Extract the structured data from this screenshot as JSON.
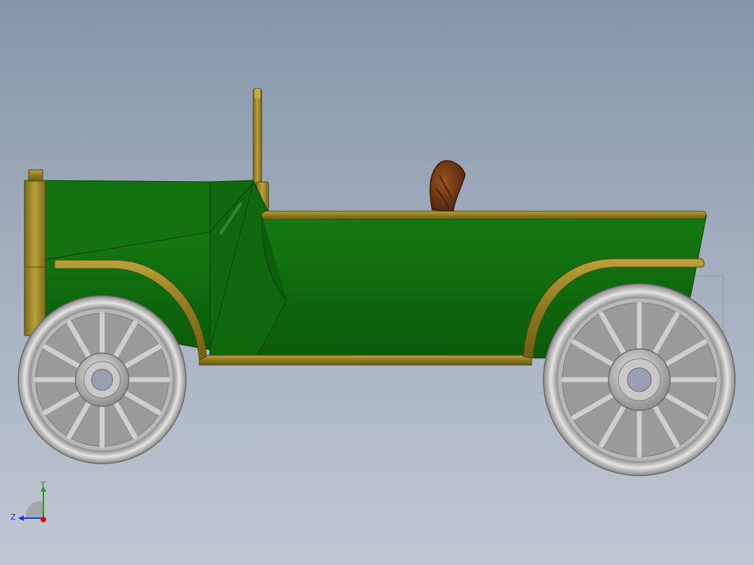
{
  "viewport": {
    "background_top": "#8795ab",
    "background_bottom": "#c0c7d3"
  },
  "model": {
    "body_color": "#0f6a0c",
    "trim_color": "#8f7c1f",
    "wheel_color": "#c8c8c8",
    "seat_color": "#6b3412"
  },
  "triad": {
    "y_label": "Y",
    "z_label": "Z",
    "y_color": "#1aa01a",
    "z_color": "#1a3ad8",
    "x_color": "#d01010"
  }
}
